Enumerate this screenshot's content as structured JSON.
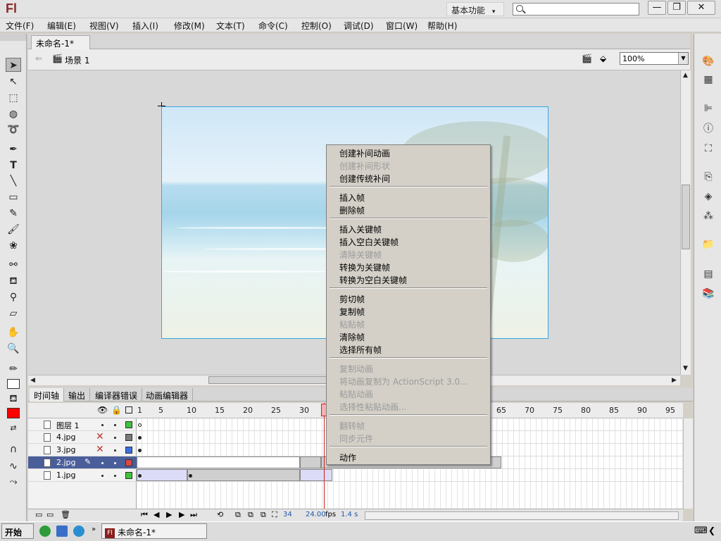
{
  "app": {
    "logo": "Fl",
    "workspace": "基本功能",
    "workspace_caret": "▾",
    "search_placeholder": ""
  },
  "window_controls": {
    "minimize": "—",
    "restore": "❐",
    "close": "✕"
  },
  "menubar": [
    "文件(F)",
    "编辑(E)",
    "视图(V)",
    "插入(I)",
    "修改(M)",
    "文本(T)",
    "命令(C)",
    "控制(O)",
    "调试(D)",
    "窗口(W)",
    "帮助(H)"
  ],
  "document": {
    "tab": "未命名-1*",
    "tab_close": "×",
    "scene": "场景 1",
    "zoom": "100%"
  },
  "timeline": {
    "tabs": [
      "时间轴",
      "输出",
      "编译器错误",
      "动画编辑器"
    ],
    "frame_numbers": [
      "1",
      "5",
      "10",
      "15",
      "20",
      "25",
      "30",
      "65",
      "70",
      "75",
      "80",
      "85",
      "90",
      "95"
    ],
    "layers": [
      {
        "name": "图层 1",
        "color": "#3ec43e",
        "hidden": false,
        "selected": false
      },
      {
        "name": "4.jpg",
        "color": "#7a7a7a",
        "hidden": true,
        "selected": false
      },
      {
        "name": "3.jpg",
        "color": "#3a6fe0",
        "hidden": true,
        "selected": false
      },
      {
        "name": "2.jpg",
        "color": "#e04545",
        "hidden": false,
        "selected": true
      },
      {
        "name": "1.jpg",
        "color": "#3ec43e",
        "hidden": false,
        "selected": false
      }
    ],
    "footer": {
      "current_frame": "34",
      "fps": "24.00",
      "fps_unit": "fps",
      "time": "1.4 s"
    }
  },
  "context_menu": {
    "groups": [
      [
        {
          "label": "创建补间动画",
          "enabled": true
        },
        {
          "label": "创建补间形状",
          "enabled": false
        },
        {
          "label": "创建传统补间",
          "enabled": true
        }
      ],
      [
        {
          "label": "插入帧",
          "enabled": true
        },
        {
          "label": "删除帧",
          "enabled": true
        }
      ],
      [
        {
          "label": "插入关键帧",
          "enabled": true
        },
        {
          "label": "插入空白关键帧",
          "enabled": true
        },
        {
          "label": "清除关键帧",
          "enabled": false
        },
        {
          "label": "转换为关键帧",
          "enabled": true
        },
        {
          "label": "转换为空白关键帧",
          "enabled": true
        }
      ],
      [
        {
          "label": "剪切帧",
          "enabled": true
        },
        {
          "label": "复制帧",
          "enabled": true
        },
        {
          "label": "粘贴帧",
          "enabled": false
        },
        {
          "label": "清除帧",
          "enabled": true
        },
        {
          "label": "选择所有帧",
          "enabled": true
        }
      ],
      [
        {
          "label": "复制动画",
          "enabled": false
        },
        {
          "label": "将动画复制为 ActionScript 3.0...",
          "enabled": false
        },
        {
          "label": "粘贴动画",
          "enabled": false
        },
        {
          "label": "选择性粘贴动画...",
          "enabled": false
        }
      ],
      [
        {
          "label": "翻转帧",
          "enabled": false
        },
        {
          "label": "同步元件",
          "enabled": false
        }
      ],
      [
        {
          "label": "动作",
          "enabled": true
        }
      ]
    ]
  },
  "taskbar": {
    "start": "开始",
    "active_window": "未命名-1*"
  },
  "colors": {
    "stroke": "#000000",
    "fill": "#ff0000",
    "accent": "#3ba6de"
  }
}
